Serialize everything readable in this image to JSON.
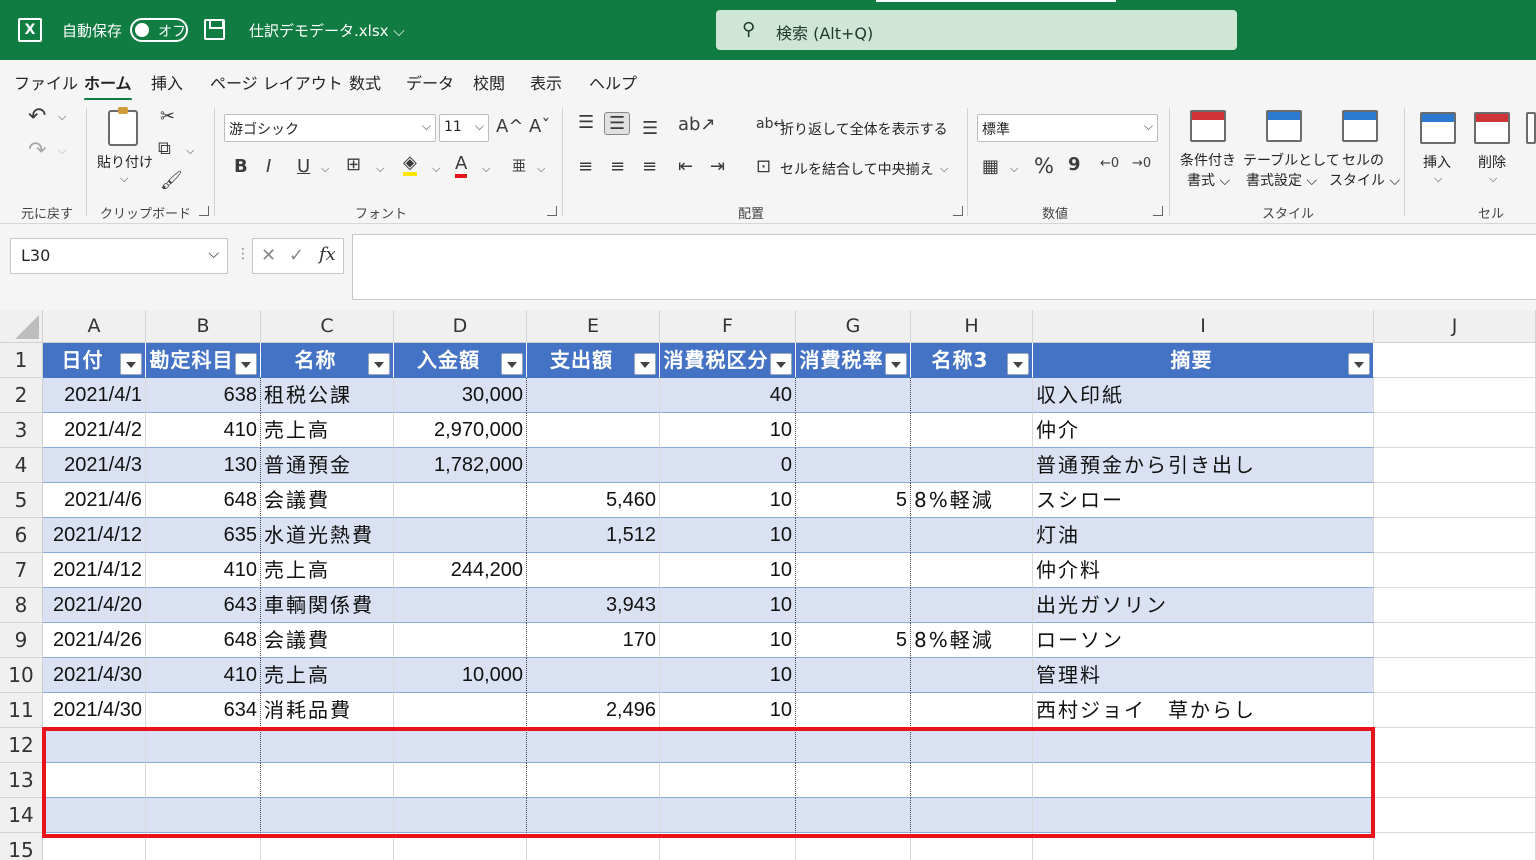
{
  "titlebar": {
    "autosave_label": "自動保存",
    "toggle_state": "オフ",
    "filename": "仕訳デモデータ.xlsx ⌵",
    "search_placeholder": "検索 (Alt+Q)",
    "logo": "X"
  },
  "tabs": [
    "ファイル",
    "ホーム",
    "挿入",
    "ページ レイアウト",
    "数式",
    "データ",
    "校閲",
    "表示",
    "ヘルプ"
  ],
  "active_tab": "ホーム",
  "ribbon": {
    "undo_label": "元に戻す",
    "paste_label": "貼り付け",
    "clipboard_label": "クリップボード",
    "font_name": "游ゴシック",
    "font_size": "11",
    "font_label": "フォント",
    "wrap_text": "折り返して全体を表示する",
    "merge_center": "セルを結合して中央揃え",
    "alignment_label": "配置",
    "number_format": "標準",
    "number_label": "数値",
    "cond_format": [
      "条件付き",
      "書式 ⌵"
    ],
    "format_table": [
      "テーブルとして",
      "書式設定 ⌵"
    ],
    "cell_styles": [
      "セルの",
      "スタイル ⌵"
    ],
    "styles_label": "スタイル",
    "insert_label": "挿入",
    "delete_label": "削除",
    "cells_label": "セル",
    "font_glyphs": {
      "bold": "B",
      "italic": "I",
      "underline": "U",
      "grow": "A^",
      "shrink": "Aˇ",
      "font_color": "A",
      "percent": "%",
      "comma": "9"
    }
  },
  "formula_bar": {
    "name_box": "L30",
    "fx": "fx",
    "cancel": "✕",
    "enter": "✓",
    "formula": ""
  },
  "sheet": {
    "columns": [
      "A",
      "B",
      "C",
      "D",
      "E",
      "F",
      "G",
      "H",
      "I",
      "J"
    ],
    "headers": [
      "日付",
      "勘定科目",
      "名称",
      "入金額",
      "支出額",
      "消費税区分",
      "消費税率",
      "名称3",
      "摘要"
    ],
    "row_numbers": [
      "1",
      "2",
      "3",
      "4",
      "5",
      "6",
      "7",
      "8",
      "9",
      "10",
      "11",
      "12",
      "13",
      "14",
      "15"
    ],
    "rows": [
      [
        "2021/4/1",
        "638",
        "租税公課",
        "30,000",
        "",
        "40",
        "",
        "",
        "収入印紙"
      ],
      [
        "2021/4/2",
        "410",
        "売上高",
        "2,970,000",
        "",
        "10",
        "",
        "",
        "仲介"
      ],
      [
        "2021/4/3",
        "130",
        "普通預金",
        "1,782,000",
        "",
        "0",
        "",
        "",
        "普通預金から引き出し"
      ],
      [
        "2021/4/6",
        "648",
        "会議費",
        "",
        "5,460",
        "10",
        "5",
        "8%軽減",
        "スシロー"
      ],
      [
        "2021/4/12",
        "635",
        "水道光熱費",
        "",
        "1,512",
        "10",
        "",
        "",
        "灯油"
      ],
      [
        "2021/4/12",
        "410",
        "売上高",
        "244,200",
        "",
        "10",
        "",
        "",
        "仲介料"
      ],
      [
        "2021/4/20",
        "643",
        "車輌関係費",
        "",
        "3,943",
        "10",
        "",
        "",
        "出光ガソリン"
      ],
      [
        "2021/4/26",
        "648",
        "会議費",
        "",
        "170",
        "10",
        "5",
        "8%軽減",
        "ローソン"
      ],
      [
        "2021/4/30",
        "410",
        "売上高",
        "10,000",
        "",
        "10",
        "",
        "",
        "管理料"
      ],
      [
        "2021/4/30",
        "634",
        "消耗品費",
        "",
        "2,496",
        "10",
        "",
        "",
        "西村ジョイ　草からし"
      ],
      [
        "",
        "",
        "",
        "",
        "",
        "",
        "",
        "",
        ""
      ],
      [
        "",
        "",
        "",
        "",
        "",
        "",
        "",
        "",
        ""
      ],
      [
        "",
        "",
        "",
        "",
        "",
        "",
        "",
        "",
        ""
      ]
    ],
    "colors": {
      "header_bg": "#4472c4",
      "band_bg": "#d9e1f2",
      "highlight": "#e8141c",
      "titlebar": "#107c41"
    }
  }
}
